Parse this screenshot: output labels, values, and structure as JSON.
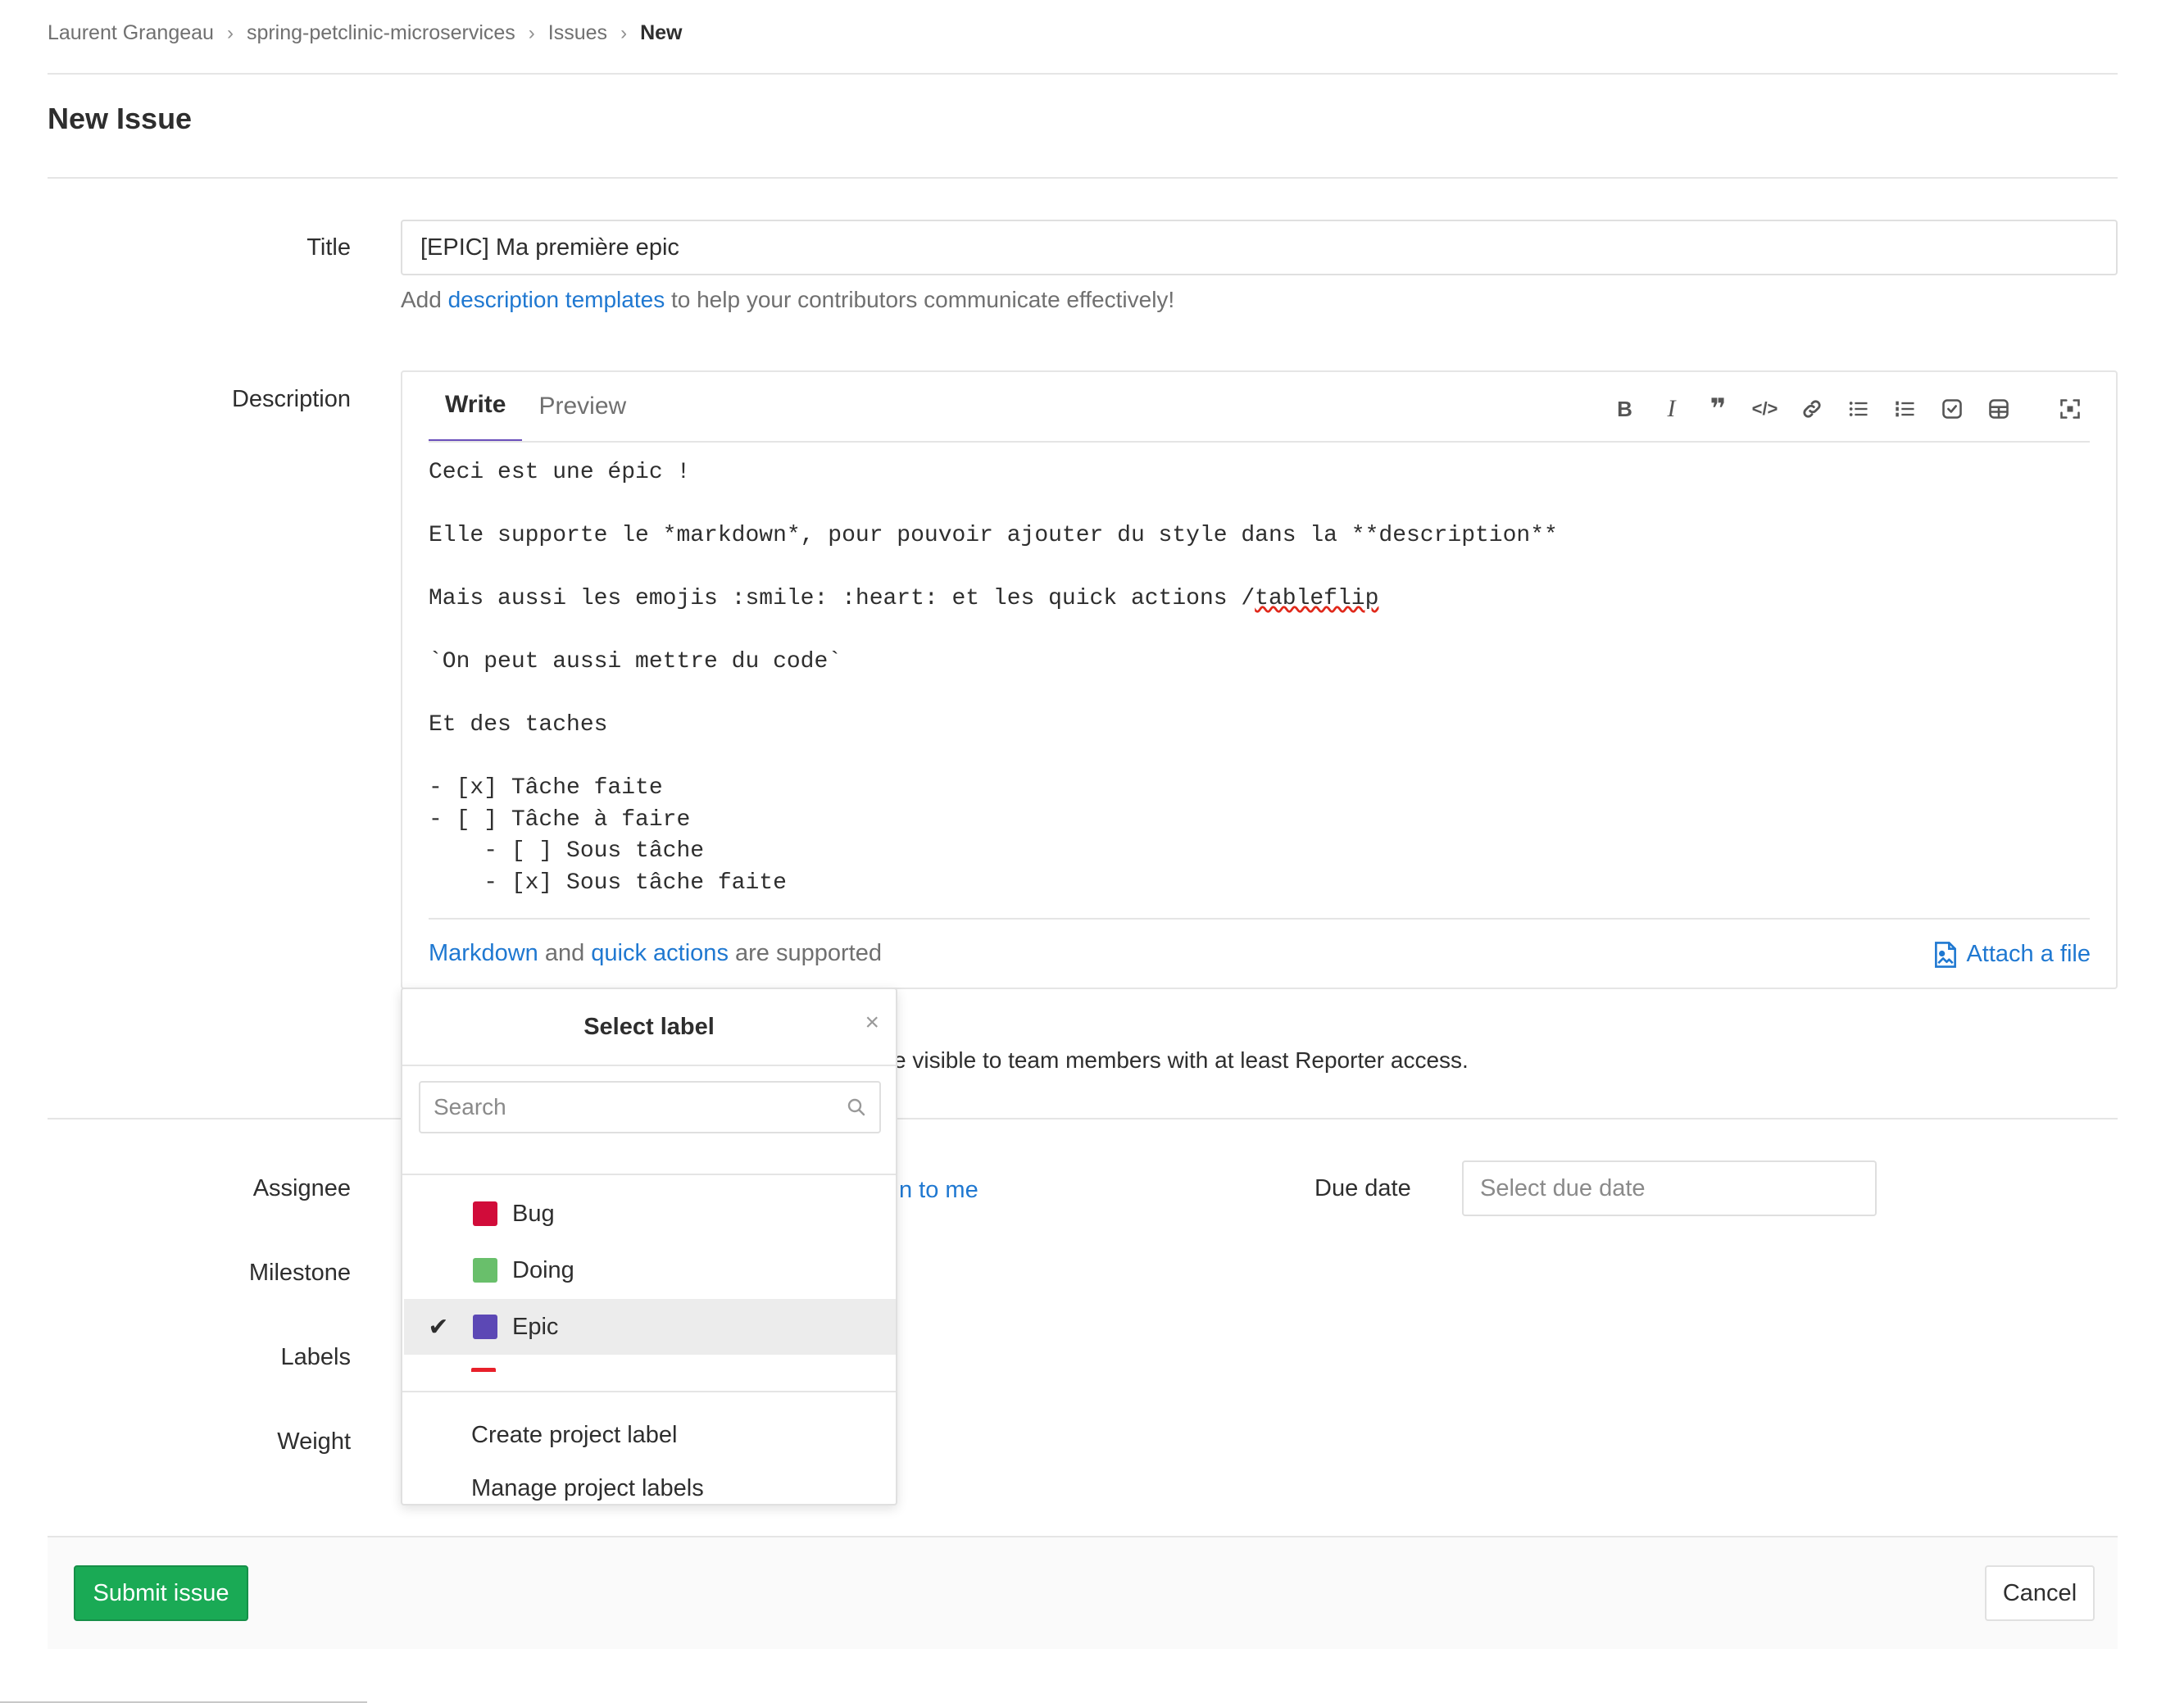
{
  "breadcrumb": {
    "items": [
      "Laurent Grangeau",
      "spring-petclinic-microservices",
      "Issues",
      "New"
    ]
  },
  "page": {
    "title": "New Issue"
  },
  "form": {
    "title_label": "Title",
    "title_value": "[EPIC] Ma première epic",
    "help_prefix": "Add",
    "help_link": "description templates",
    "help_suffix": "to help your contributors communicate effectively!",
    "description_label": "Description",
    "tabs": {
      "write": "Write",
      "preview": "Preview"
    },
    "toolbar_icons": [
      "bold-icon",
      "italic-icon",
      "quote-icon",
      "code-icon",
      "link-icon",
      "bullet-list-icon",
      "numbered-list-icon",
      "task-list-icon",
      "table-icon",
      "fullscreen-icon"
    ],
    "description_lines": {
      "l1": "Ceci est une épic !",
      "l2": "Elle supporte le *markdown*, pour pouvoir ajouter du style dans la **description**",
      "l3_prefix": "Mais aussi les emojis :smile: :heart: et les quick actions /",
      "l3_spell": "tableflip",
      "l4": "`On peut aussi mettre du code`",
      "l5": "Et des taches",
      "l6": "- [x] Tâche faite",
      "l7": "- [ ] Tâche à faire",
      "l8": "    - [ ] Sous tâche",
      "l9": "    - [x] Sous tâche faite"
    },
    "markdown_link": "Markdown",
    "and_text": "and",
    "quick_actions_link": "quick actions",
    "supported_text": "are supported",
    "attach_label": "Attach a file",
    "confidential_text": "e visible to team members with at least Reporter access.",
    "assignee_label": "Assignee",
    "assign_to_me_fragment": "n to me",
    "milestone_label": "Milestone",
    "labels_label": "Labels",
    "weight_label": "Weight",
    "due_date_label": "Due date",
    "due_date_placeholder": "Select due date"
  },
  "label_dropdown": {
    "title": "Select label",
    "close_glyph": "×",
    "search_placeholder": "Search",
    "items": [
      {
        "name": "Bug",
        "color": "#d10c3a",
        "checked": false
      },
      {
        "name": "Doing",
        "color": "#69bf6b",
        "checked": false
      },
      {
        "name": "Epic",
        "color": "#5c48b5",
        "checked": true
      }
    ],
    "partial_item_color": "#e8202a",
    "create_label": "Create project label",
    "manage_label": "Manage project labels"
  },
  "actions": {
    "submit": "Submit issue",
    "cancel": "Cancel"
  },
  "colors": {
    "link": "#1f78d1",
    "submit_bg": "#1aaa55",
    "tab_active": "#6b4fbb"
  }
}
